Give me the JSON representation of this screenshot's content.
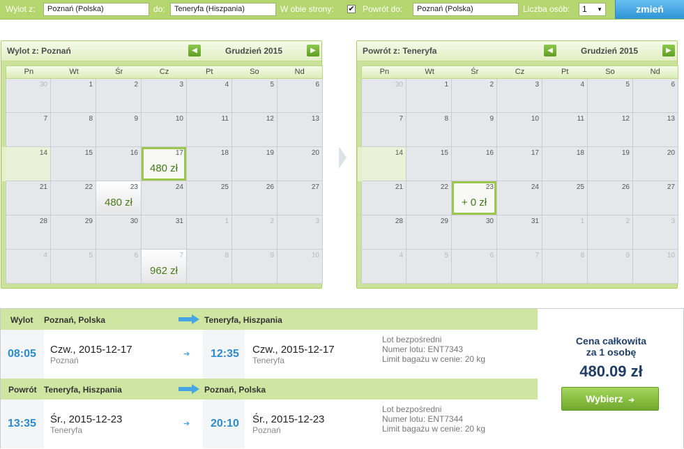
{
  "search": {
    "from_label": "Wylot z:",
    "from_value": "Poznań (Polska)",
    "to_label": "do:",
    "to_value": "Teneryfa (Hiszpania)",
    "roundtrip_label": "W obie strony:",
    "roundtrip_checked": "✔",
    "return_label": "Powrót do:",
    "return_value": "Poznań (Polska)",
    "persons_label": "Liczba osób:",
    "persons_value": "1",
    "change_button": "zmień"
  },
  "weekdays": [
    "Pn",
    "Wt",
    "Śr",
    "Cz",
    "Pt",
    "So",
    "Nd"
  ],
  "calendars": [
    {
      "title": "Wylot z: Poznań",
      "month": "Grudzień 2015",
      "weeks": [
        [
          {
            "d": "30",
            "o": 1
          },
          {
            "d": "1"
          },
          {
            "d": "2"
          },
          {
            "d": "3"
          },
          {
            "d": "4"
          },
          {
            "d": "5"
          },
          {
            "d": "6"
          }
        ],
        [
          {
            "d": "7"
          },
          {
            "d": "8"
          },
          {
            "d": "9"
          },
          {
            "d": "10"
          },
          {
            "d": "11"
          },
          {
            "d": "12"
          },
          {
            "d": "13"
          }
        ],
        [
          {
            "d": "14",
            "hl": 1
          },
          {
            "d": "15"
          },
          {
            "d": "16"
          },
          {
            "d": "17",
            "p": "480 zł",
            "sel": 1
          },
          {
            "d": "18"
          },
          {
            "d": "19"
          },
          {
            "d": "20"
          }
        ],
        [
          {
            "d": "21"
          },
          {
            "d": "22"
          },
          {
            "d": "23",
            "p": "480 zł"
          },
          {
            "d": "24"
          },
          {
            "d": "25"
          },
          {
            "d": "26"
          },
          {
            "d": "27"
          }
        ],
        [
          {
            "d": "28"
          },
          {
            "d": "29"
          },
          {
            "d": "30"
          },
          {
            "d": "31"
          },
          {
            "d": "1",
            "o": 1
          },
          {
            "d": "2",
            "o": 1
          },
          {
            "d": "3",
            "o": 1
          }
        ],
        [
          {
            "d": "4",
            "o": 1
          },
          {
            "d": "5",
            "o": 1
          },
          {
            "d": "6",
            "o": 1
          },
          {
            "d": "7",
            "o": 1,
            "p": "962 zł"
          },
          {
            "d": "8",
            "o": 1
          },
          {
            "d": "9",
            "o": 1
          },
          {
            "d": "10",
            "o": 1
          }
        ]
      ]
    },
    {
      "title": "Powrót z: Teneryfa",
      "month": "Grudzień 2015",
      "weeks": [
        [
          {
            "d": "30",
            "o": 1
          },
          {
            "d": "1"
          },
          {
            "d": "2"
          },
          {
            "d": "3"
          },
          {
            "d": "4"
          },
          {
            "d": "5"
          },
          {
            "d": "6"
          }
        ],
        [
          {
            "d": "7"
          },
          {
            "d": "8"
          },
          {
            "d": "9"
          },
          {
            "d": "10"
          },
          {
            "d": "11"
          },
          {
            "d": "12"
          },
          {
            "d": "13"
          }
        ],
        [
          {
            "d": "14",
            "hl": 1
          },
          {
            "d": "15"
          },
          {
            "d": "16"
          },
          {
            "d": "17"
          },
          {
            "d": "18"
          },
          {
            "d": "19"
          },
          {
            "d": "20"
          }
        ],
        [
          {
            "d": "21"
          },
          {
            "d": "22"
          },
          {
            "d": "23",
            "p": "+ 0 zł",
            "sel": 1
          },
          {
            "d": "24"
          },
          {
            "d": "25"
          },
          {
            "d": "26"
          },
          {
            "d": "27"
          }
        ],
        [
          {
            "d": "28"
          },
          {
            "d": "29"
          },
          {
            "d": "30"
          },
          {
            "d": "31"
          },
          {
            "d": "1",
            "o": 1
          },
          {
            "d": "2",
            "o": 1
          },
          {
            "d": "3",
            "o": 1
          }
        ],
        [
          {
            "d": "4",
            "o": 1
          },
          {
            "d": "5",
            "o": 1
          },
          {
            "d": "6",
            "o": 1
          },
          {
            "d": "7",
            "o": 1
          },
          {
            "d": "8",
            "o": 1
          },
          {
            "d": "9",
            "o": 1
          },
          {
            "d": "10",
            "o": 1
          }
        ]
      ]
    }
  ],
  "outbound": {
    "label": "Wylot",
    "from": "Poznań, Polska",
    "to": "Teneryfa, Hiszpania",
    "dep_time": "08:05",
    "dep_date": "Czw., 2015-12-17",
    "dep_city": "Poznań",
    "arr_time": "12:35",
    "arr_date": "Czw., 2015-12-17",
    "arr_city": "Teneryfa",
    "info1": "Lot bezpośredni",
    "info2": "Numer lotu: ENT7343",
    "info3": "Limit bagażu w cenie: 20 kg"
  },
  "return": {
    "label": "Powrót",
    "from": "Teneryfa, Hiszpania",
    "to": "Poznań, Polska",
    "dep_time": "13:35",
    "dep_date": "Śr., 2015-12-23",
    "dep_city": "Teneryfa",
    "arr_time": "20:10",
    "arr_date": "Śr., 2015-12-23",
    "arr_city": "Poznań",
    "info1": "Lot bezpośredni",
    "info2": "Numer lotu: ENT7344",
    "info3": "Limit bagażu w cenie: 20 kg"
  },
  "price": {
    "title_line1": "Cena całkowita",
    "title_line2": "za 1 osobę",
    "value": "480.09 zł",
    "select_button": "Wybierz"
  },
  "colors": {
    "accent_green": "#b5d56f",
    "accent_blue": "#2f93d6",
    "price_text": "#4b7a1a",
    "time_text": "#2b8ccf"
  }
}
